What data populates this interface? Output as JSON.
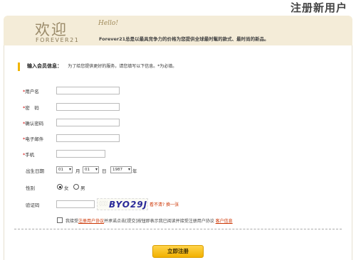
{
  "page_title": "注册新用户",
  "banner": {
    "logo_cn": "欢迎",
    "logo_en": "FOREVER21",
    "hello": "Hello!",
    "slogan": "Forever21总是以最具竞争力的价格为您提供全球最时髦的款式、最时尚的新品。"
  },
  "section": {
    "title": "输入会员信息：",
    "desc": "为了给您提供更好的服务，请您填写以下信息。*为必填。"
  },
  "fields": {
    "username_label": "用户名",
    "password_label": "密　码",
    "confirm_label": "确认密码",
    "email_label": "电子邮件",
    "phone_label": "手机",
    "star": "*"
  },
  "birthday": {
    "label": "出生日期",
    "month_value": "01",
    "month_unit": "月",
    "day_value": "01",
    "day_unit": "日",
    "year_value": "1987",
    "year_unit": "年"
  },
  "gender": {
    "label": "性别",
    "female": "女",
    "male": "男",
    "selected": "女"
  },
  "captcha": {
    "label": "验证码",
    "code": "BYO29J",
    "refresh": "看不清? 换一张"
  },
  "agree": {
    "prefix": "我接受",
    "terms_link": "注册用户协议",
    "middle": "并承诺点击[提交]按钮即表示我已阅读并接受注册用户协议",
    "privacy_link": "客户信息"
  },
  "submit_label": "立即注册",
  "colors": {
    "accent": "#f1b500",
    "banner_bg": "#f4ecd8",
    "link_red": "#cc3300"
  }
}
